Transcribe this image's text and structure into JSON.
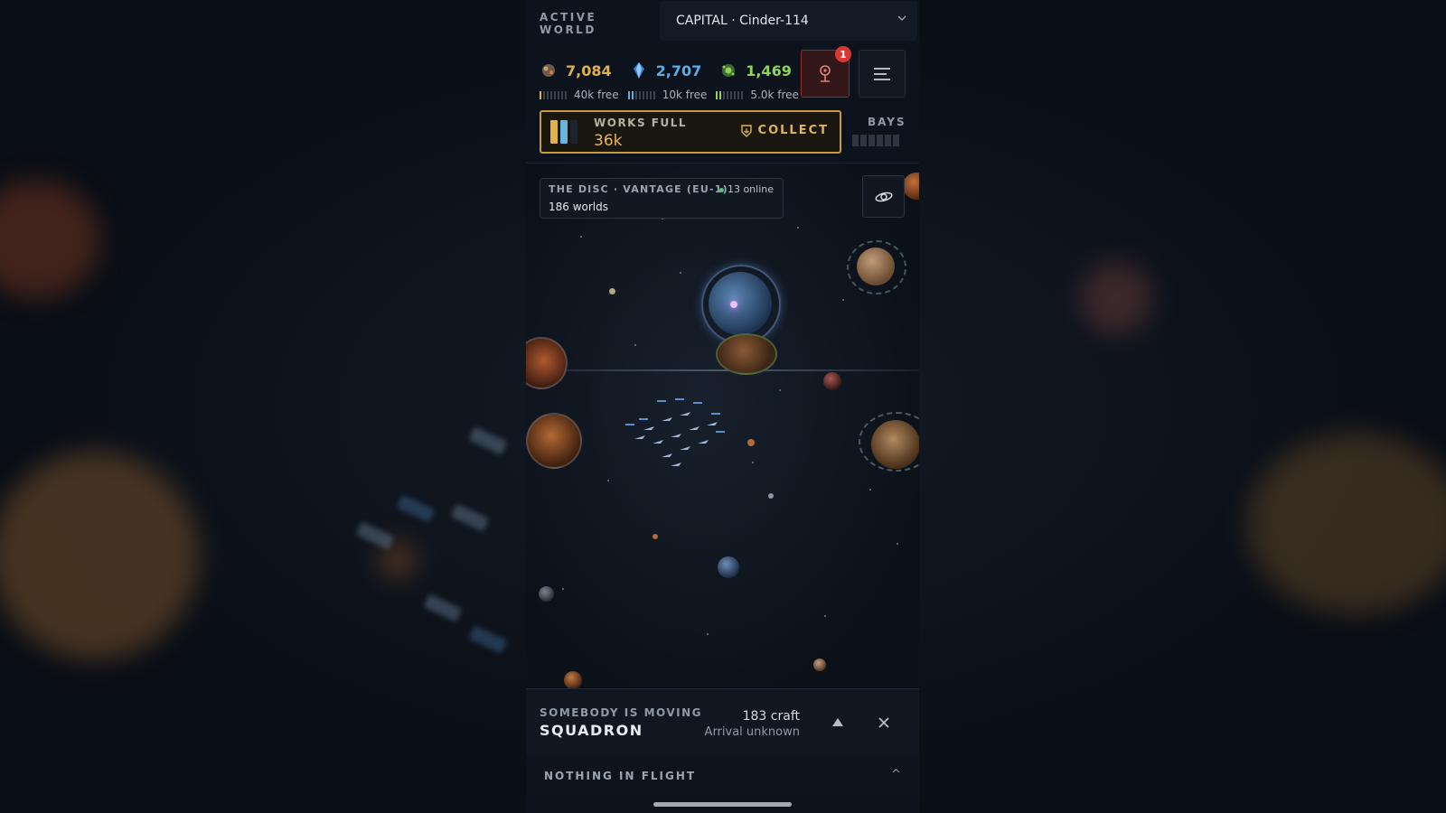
{
  "header": {
    "active_label": "ACTIVE WORLD",
    "world_select": {
      "value": "CAPITAL · Cinder-114",
      "icon": "chevron-down-icon"
    }
  },
  "resources": [
    {
      "name": "ore",
      "icon": "ore-icon",
      "value": "7,084",
      "free": "40k free",
      "color": "#e0b049"
    },
    {
      "name": "crystal",
      "icon": "crystal-icon",
      "value": "2,707",
      "free": "10k free",
      "color": "#5aaee6"
    },
    {
      "name": "bio",
      "icon": "bio-icon",
      "value": "1,469",
      "free": "5.0k free",
      "color": "#8fd35a"
    }
  ],
  "alert": {
    "icon": "beacon-icon",
    "badge": "1"
  },
  "menu": {
    "icon": "menu-icon"
  },
  "works": {
    "label": "WORKS FULL",
    "amount": "36k",
    "collect_label": "COLLECT",
    "collect_icon": "shield-download-icon"
  },
  "bays": {
    "label": "BAYS",
    "count": 6
  },
  "map": {
    "region": "THE DISC · VANTAGE (EU-1)",
    "online": "13 online",
    "worlds": "186 worlds",
    "view_icon": "orbit-view-icon"
  },
  "movement": {
    "label": "SOMEBODY IS MOVING",
    "name": "SQUADRON",
    "craft": "183 craft",
    "arrival": "Arrival unknown",
    "expand_icon": "triangle-up-icon",
    "close_icon": "close-icon"
  },
  "flight": {
    "label": "NOTHING IN FLIGHT",
    "caret": "^"
  },
  "colors": {
    "accent_gold": "#c79a3e",
    "alert_red": "#d8382f",
    "online_green": "#4ec77a"
  }
}
